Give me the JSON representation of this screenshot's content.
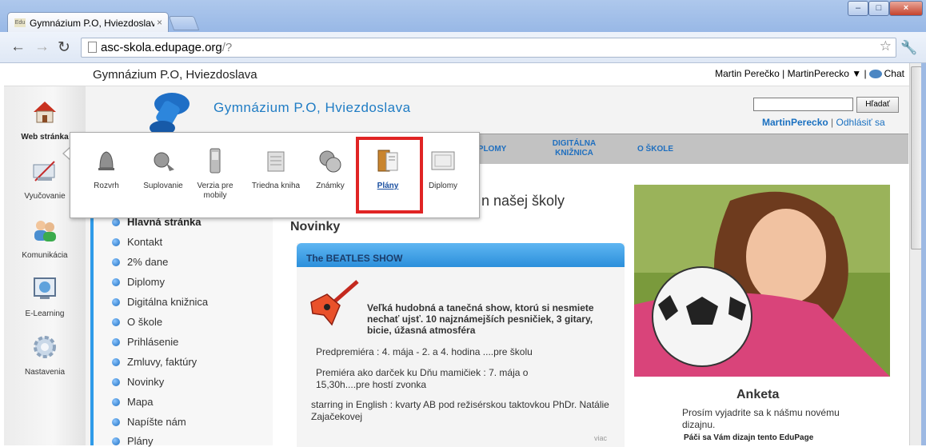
{
  "browser": {
    "tab_title": "Gymnázium P.O, Hviezdoslava",
    "tab_close": "×",
    "favicon_text": "Edu",
    "url_host": "asc-skola.edupage.org",
    "url_path": "/?"
  },
  "top_bar": {
    "school_name": "Gymnázium P.O, Hviezdoslava",
    "user_text": "Martin Perečko | MartinPerecko ▼ |",
    "chat_label": "Chat"
  },
  "left_nav": [
    {
      "label": "Web stránka",
      "icon": "house-icon"
    },
    {
      "label": "Vyučovanie",
      "icon": "teaching-icon"
    },
    {
      "label": "Komunikácia",
      "icon": "people-icon"
    },
    {
      "label": "E-Learning",
      "icon": "monitor-icon"
    },
    {
      "label": "Nastavenia",
      "icon": "gear-icon"
    }
  ],
  "header": {
    "title": "Gymnázium P.O, Hviezdoslava",
    "search_button": "Hľadať",
    "username": "MartinPerecko",
    "separator": "|",
    "logout": "Odhlásiť sa"
  },
  "menu": [
    {
      "label": "IPLOMY"
    },
    {
      "label": "DIGITÁLNA KNIŽNICA"
    },
    {
      "label": "O ŠKOLE"
    }
  ],
  "popup": [
    {
      "label": "Rozvrh",
      "icon": "bell-icon"
    },
    {
      "label": "Suplovanie",
      "icon": "substitution-icon"
    },
    {
      "label": "Verzia pre mobily",
      "icon": "mobile-phone-icon"
    },
    {
      "label": "Triedna kniha",
      "icon": "class-book-icon"
    },
    {
      "label": "Známky",
      "icon": "grades-icon"
    },
    {
      "label": "Plány",
      "icon": "plans-icon",
      "selected": true
    },
    {
      "label": "Diplomy",
      "icon": "diploma-icon"
    }
  ],
  "sidebar_items": [
    "Hlavná stránka",
    "Kontakt",
    "2% dane",
    "Diplomy",
    "Digitálna knižnica",
    "O škole",
    "Prihlásenie",
    "Zmluvy, faktúry",
    "Novinky",
    "Mapa",
    "Napíšte nám",
    "Plány"
  ],
  "main": {
    "welcome_suffix": "n našej školy",
    "news_heading": "Novinky",
    "news_title": "The BEATLES SHOW",
    "news_bold": "Veľká hudobná a tanečná show, ktorú si nesmiete nechať ujsť. 10 najznámejších pesničiek, 3 gitary, bicie, úžasná atmosféra",
    "news_p1": "Predpremiéra : 4. mája  - 2. a 4. hodina  ....pre školu",
    "news_p2": "Premiéra ako darček ku Dňu mamičiek : 7. mája o 15,30h....pre hostí zvonka",
    "news_p3": "starring in English : kvarty AB  pod režisérskou taktovkou PhDr. Natálie Zajačekovej",
    "more": "viac"
  },
  "poll": {
    "title": "Anketa",
    "text": "Prosím vyjadrite sa k nášmu novému dizajnu.",
    "question": "Páči sa Vám dizajn tento EduPage"
  }
}
